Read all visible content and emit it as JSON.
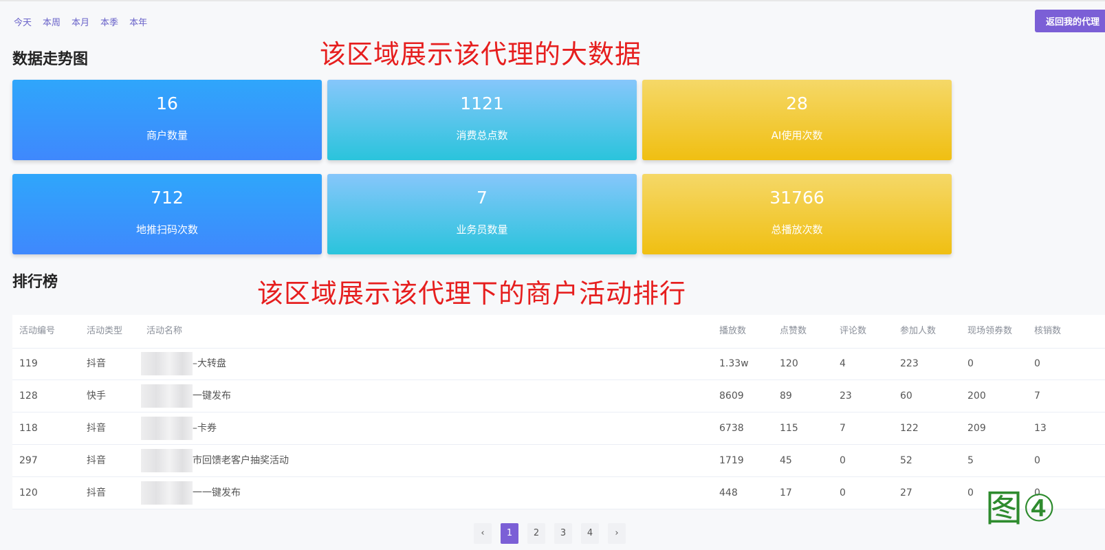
{
  "time_filters": [
    "今天",
    "本周",
    "本月",
    "本季",
    "本年"
  ],
  "back_button": "返回我的代理",
  "trend_title": "数据走势图",
  "annotation_top": "该区域展示该代理的大数据",
  "stats": [
    {
      "value": "16",
      "label": "商户数量"
    },
    {
      "value": "1121",
      "label": "消费总点数"
    },
    {
      "value": "28",
      "label": "AI使用次数"
    },
    {
      "value": "712",
      "label": "地推扫码次数"
    },
    {
      "value": "7",
      "label": "业务员数量"
    },
    {
      "value": "31766",
      "label": "总播放次数"
    }
  ],
  "ranking_title": "排行榜",
  "annotation_bottom": "该区域展示该代理下的商户活动排行",
  "table": {
    "headers": [
      "活动编号",
      "活动类型",
      "活动名称",
      "播放数",
      "点赞数",
      "评论数",
      "参加人数",
      "现场领券数",
      "核销数"
    ],
    "rows": [
      [
        "119",
        "抖音",
        "–大转盘",
        "1.33w",
        "120",
        "4",
        "223",
        "0",
        "0"
      ],
      [
        "128",
        "快手",
        "一键发布",
        "8609",
        "89",
        "23",
        "60",
        "200",
        "7"
      ],
      [
        "118",
        "抖音",
        "–卡券",
        "6738",
        "115",
        "7",
        "122",
        "209",
        "13"
      ],
      [
        "297",
        "抖音",
        "市回馈老客户抽奖活动",
        "1719",
        "45",
        "0",
        "52",
        "5",
        "0"
      ],
      [
        "120",
        "抖音",
        "一一键发布",
        "448",
        "17",
        "0",
        "27",
        "0",
        "0"
      ]
    ]
  },
  "pagination": {
    "prev": "‹",
    "pages": [
      "1",
      "2",
      "3",
      "4"
    ],
    "next": "›",
    "current": "1"
  },
  "figure_label": "图④",
  "colors": {
    "accent": "#7b5fd6",
    "annotation": "#e61e1e",
    "figure_label": "#2e8b2e"
  }
}
